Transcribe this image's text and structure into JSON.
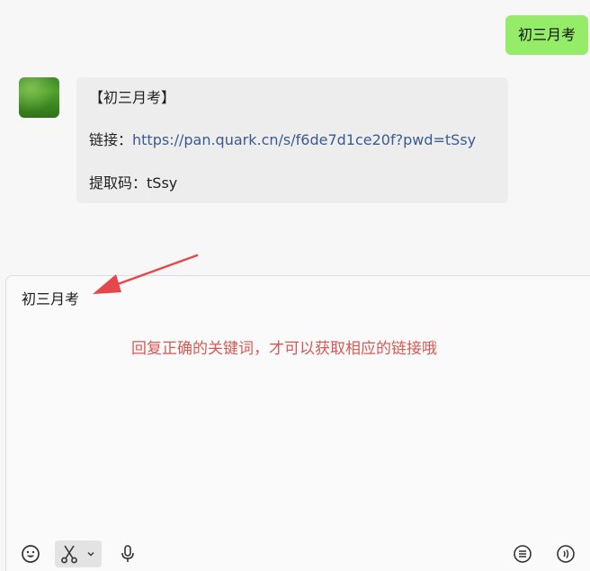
{
  "messages": {
    "outgoing": {
      "text": "初三月考"
    },
    "incoming": {
      "title": "【初三月考】",
      "link_label": "链接：",
      "link_url": "https://pan.quark.cn/s/f6de7d1ce20f?pwd=tSsy",
      "code_label": "提取码：",
      "code_value": "tSsy"
    }
  },
  "input": {
    "value": "初三月考"
  },
  "annotation": {
    "text": "回复正确的关键词，才可以获取相应的链接哦",
    "color": "#d45a55"
  },
  "toolbar": {
    "icons": [
      "emoji-icon",
      "scissors-icon",
      "chevron-down-icon",
      "microphone-icon",
      "chat-history-icon",
      "voice-input-icon"
    ]
  },
  "colors": {
    "outgoing_bubble": "#95ec69",
    "incoming_bubble": "#ededed",
    "link": "#3b5a8f",
    "arrow": "#e4484a"
  }
}
